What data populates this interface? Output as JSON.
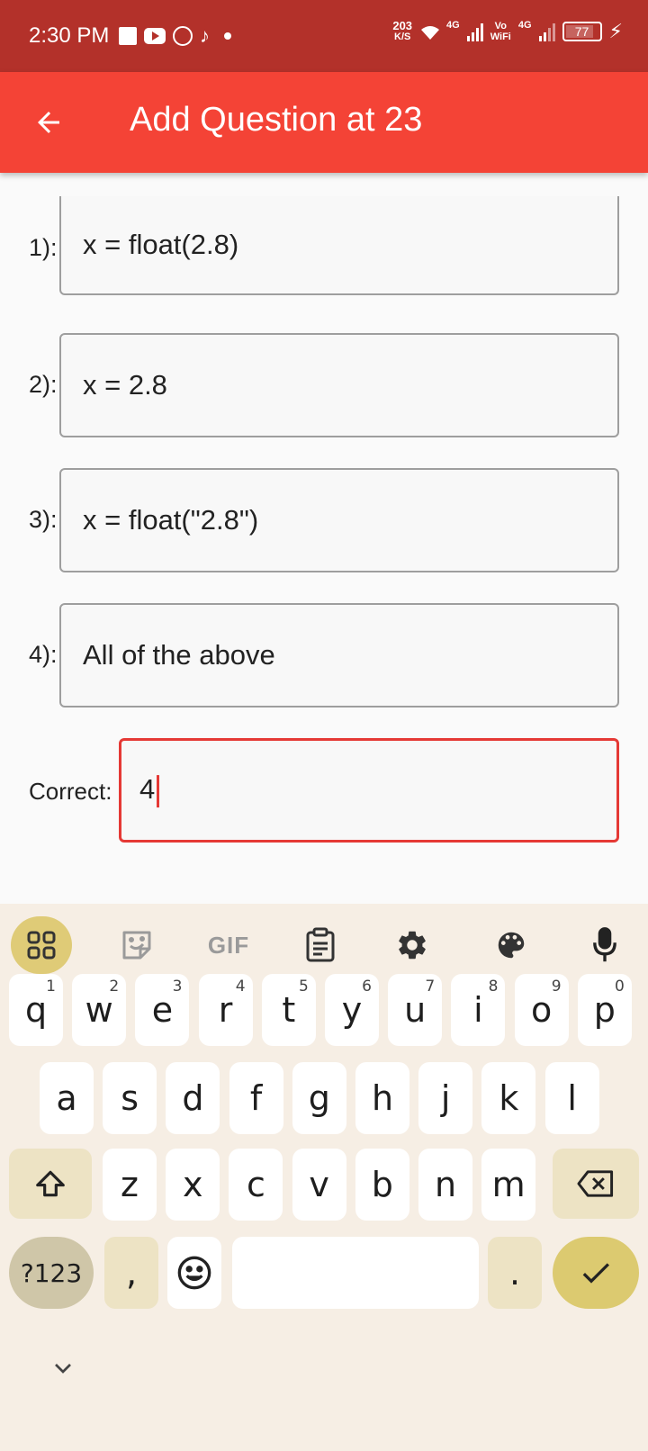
{
  "status_bar": {
    "time": "2:30 PM",
    "speed_value": "203",
    "speed_unit": "K/S",
    "network1": "4G",
    "volte_top": "Vo",
    "volte_bottom": "WiFi",
    "network2": "4G",
    "battery": "77",
    "icons": [
      "notification-square-icon",
      "youtube-icon",
      "whatsapp-icon",
      "tiktok-icon",
      "dot-icon",
      "wifi-icon",
      "signal-icon",
      "battery-icon",
      "charging-icon"
    ]
  },
  "app_bar": {
    "title": "Add Question at 23",
    "back_icon": "arrow-left-icon",
    "color": "#f44336"
  },
  "options": [
    {
      "label": "1):",
      "value": "x = float(2.8)"
    },
    {
      "label": "2):",
      "value": "x = 2.8"
    },
    {
      "label": "3):",
      "value": "x = float(\"2.8\")"
    },
    {
      "label": "4):",
      "value": "All of the above"
    }
  ],
  "correct": {
    "label": "Correct:",
    "value": "4",
    "accent": "#e53935"
  },
  "keyboard": {
    "toolbar": [
      "apps-icon",
      "sticker-icon",
      "GIF",
      "clipboard-icon",
      "gear-icon",
      "palette-icon",
      "microphone-icon"
    ],
    "row1": [
      {
        "k": "q",
        "h": "1"
      },
      {
        "k": "w",
        "h": "2"
      },
      {
        "k": "e",
        "h": "3"
      },
      {
        "k": "r",
        "h": "4"
      },
      {
        "k": "t",
        "h": "5"
      },
      {
        "k": "y",
        "h": "6"
      },
      {
        "k": "u",
        "h": "7"
      },
      {
        "k": "i",
        "h": "8"
      },
      {
        "k": "o",
        "h": "9"
      },
      {
        "k": "p",
        "h": "0"
      }
    ],
    "row2": [
      "a",
      "s",
      "d",
      "f",
      "g",
      "h",
      "j",
      "k",
      "l"
    ],
    "row3": [
      "z",
      "x",
      "c",
      "v",
      "b",
      "n",
      "m"
    ],
    "symbols_label": "?123",
    "comma": ",",
    "period": ".",
    "enter_icon": "check-icon",
    "shift_icon": "shift-icon",
    "backspace_icon": "backspace-icon",
    "emoji_icon": "emoji-icon",
    "hide_icon": "chevron-down-icon"
  }
}
